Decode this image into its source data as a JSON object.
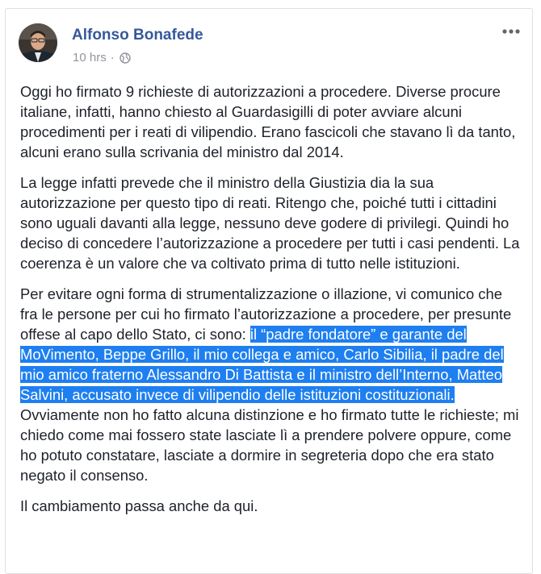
{
  "post": {
    "author": "Alfonso Bonafede",
    "time": "10 hrs",
    "separator": "·",
    "privacy_icon": "globe-icon",
    "more_icon": "more-options-icon",
    "paragraphs": [
      "Oggi ho firmato 9 richieste di autorizzazioni a procedere. Diverse procure italiane, infatti, hanno chiesto al Guardasigilli di poter avviare alcuni procedimenti per i reati di vilipendio. Erano fascicoli che stavano lì da tanto, alcuni erano sulla scrivania del ministro dal 2014.",
      "La legge infatti prevede che il ministro della Giustizia dia la sua autorizzazione per questo tipo di reati. Ritengo che, poiché tutti i cittadini sono uguali davanti alla legge, nessuno deve godere di privilegi. Quindi ho deciso di concedere l’autorizzazione a procedere per tutti i casi pendenti. La coerenza è un valore che va coltivato prima di tutto nelle istituzioni."
    ],
    "p3_before": "Per evitare ogni forma di strumentalizzazione o illazione, vi comunico che fra le persone per cui ho firmato l’autorizzazione a procedere, per presunte offese al capo dello Stato, ci sono: ",
    "p3_highlight": "il “padre fondatore” e garante del MoVimento, Beppe Grillo, il mio collega e amico, Carlo Sibilia, il padre del mio amico fraterno Alessandro Di Battista e il ministro dell’Interno, Matteo Salvini, accusato invece di vilipendio delle istituzioni costituzionali.",
    "p3_after": " Ovviamente non ho fatto alcuna distinzione e ho firmato tutte le richieste; mi chiedo come mai fossero state lasciate lì a prendere polvere oppure, come ho potuto constatare, lasciate a dormire in segreteria dopo che era stato negato il consenso.",
    "closing": "Il cambiamento passa anche da qui."
  },
  "colors": {
    "author": "#365899",
    "meta": "#90949c",
    "text": "#1d2129",
    "highlight": "#1e7ff0"
  }
}
